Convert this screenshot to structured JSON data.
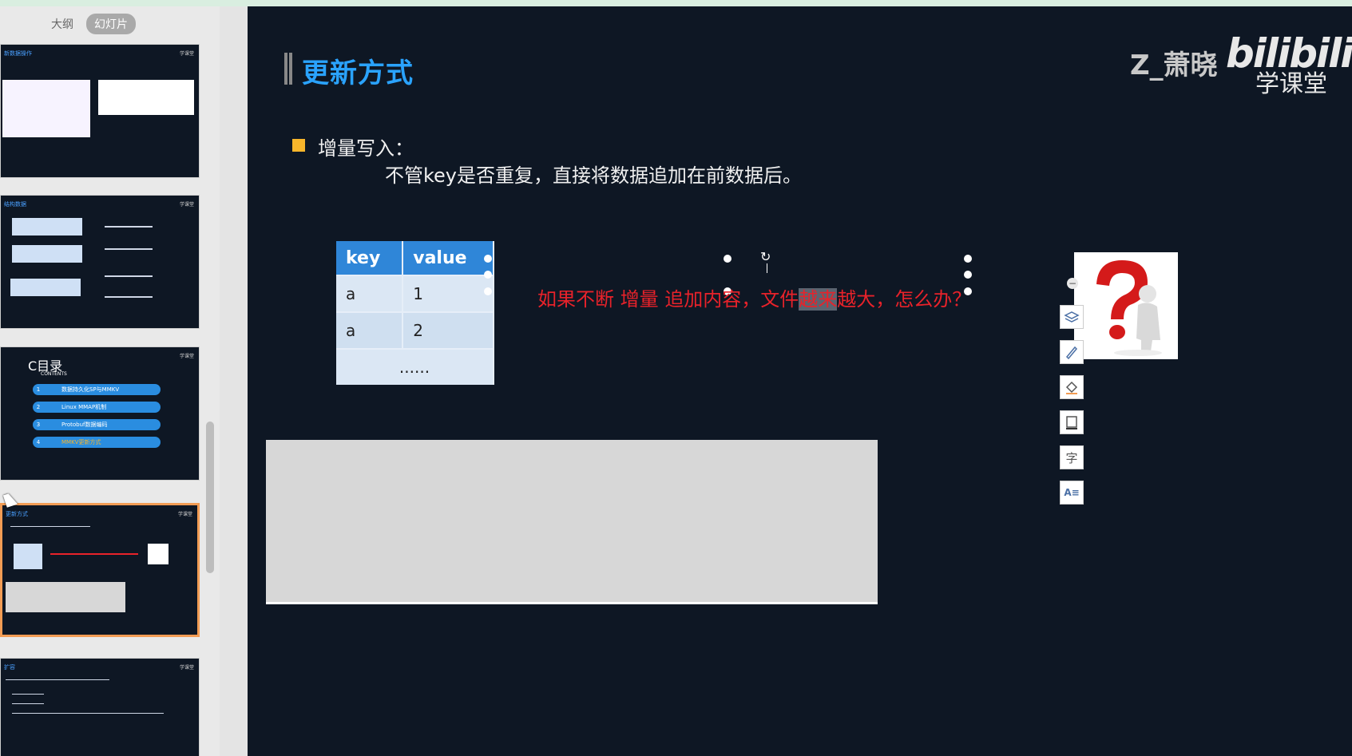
{
  "view_tabs": {
    "outline": "大纲",
    "slides": "幻灯片"
  },
  "thumbnails": [
    {
      "title": "新数据操作",
      "logo": "学课堂"
    },
    {
      "title": "结构数据",
      "logo": "学课堂"
    },
    {
      "title": "C目录",
      "subtitle": "CONTENTS",
      "logo": "学课堂",
      "items": [
        {
          "num": "1",
          "label": "数据持久化SP与MMKV"
        },
        {
          "num": "2",
          "label": "Linux MMAP机制"
        },
        {
          "num": "3",
          "label": "Protobuf数据编码"
        },
        {
          "num": "4",
          "label": "MMKV更新方式"
        }
      ]
    },
    {
      "title": "更新方式",
      "logo": "学课堂",
      "selected": true
    },
    {
      "title": "扩容",
      "logo": "学课堂"
    }
  ],
  "slide": {
    "title": "更新方式",
    "brand_name": "Z_萧晓",
    "brand_logo": "bilibili",
    "brand_sub": "学课堂",
    "bullet_title": "增量写入：",
    "bullet_desc": "不管key是否重复，直接将数据追加在前数据后。",
    "table": {
      "headers": [
        "key",
        "value"
      ],
      "rows": [
        [
          "a",
          "1"
        ],
        [
          "a",
          "2"
        ],
        [
          "......"
        ]
      ]
    },
    "question_before": "如果不断 增量 追加内容，文件",
    "question_highlight": "越来",
    "question_after": "越大，怎么办？",
    "accent": "#2aa3ff",
    "question_color": "#e8222a"
  },
  "toolbar": [
    "layers-icon",
    "pen-icon",
    "fill-icon",
    "border-icon",
    "text-icon",
    "text-style-icon"
  ]
}
